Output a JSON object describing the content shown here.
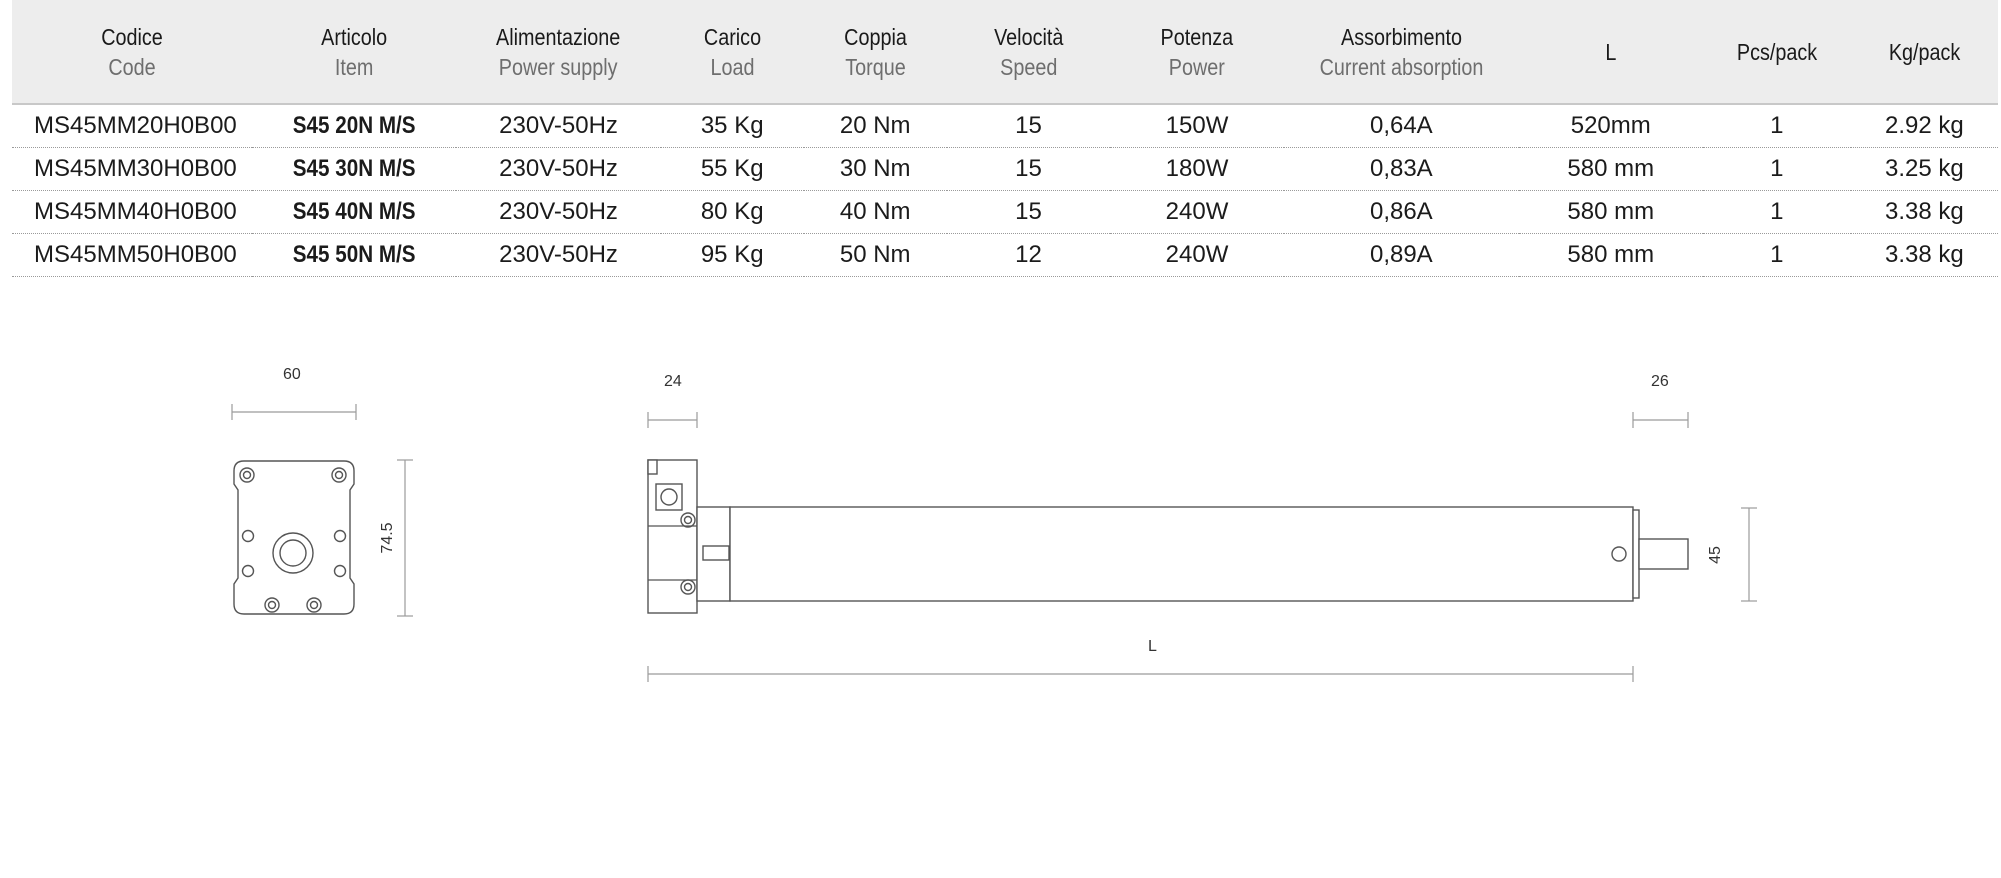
{
  "table": {
    "headers": [
      {
        "it": "Codice",
        "en": "Code"
      },
      {
        "it": "Articolo",
        "en": "Item"
      },
      {
        "it": "Alimentazione",
        "en": "Power supply"
      },
      {
        "it": "Carico",
        "en": "Load"
      },
      {
        "it": "Coppia",
        "en": "Torque"
      },
      {
        "it": "Velocità",
        "en": "Speed"
      },
      {
        "it": "Potenza",
        "en": "Power"
      },
      {
        "it": "Assorbimento",
        "en": "Current absorption"
      },
      {
        "it": "L",
        "en": ""
      },
      {
        "it": "Pcs/pack",
        "en": ""
      },
      {
        "it": "Kg/pack",
        "en": ""
      }
    ],
    "rows": [
      [
        "MS45MM20H0B00",
        "S45 20N M/S",
        "230V-50Hz",
        "35 Kg",
        "20 Nm",
        "15",
        "150W",
        "0,64A",
        "520mm",
        "1",
        "2.92 kg"
      ],
      [
        "MS45MM30H0B00",
        "S45 30N M/S",
        "230V-50Hz",
        "55 Kg",
        "30 Nm",
        "15",
        "180W",
        "0,83A",
        "580 mm",
        "1",
        "3.25 kg"
      ],
      [
        "MS45MM40H0B00",
        "S45 40N M/S",
        "230V-50Hz",
        "80 Kg",
        "40 Nm",
        "15",
        "240W",
        "0,86A",
        "580 mm",
        "1",
        "3.38 kg"
      ],
      [
        "MS45MM50H0B00",
        "S45 50N M/S",
        "230V-50Hz",
        "95 Kg",
        "50 Nm",
        "12",
        "240W",
        "0,89A",
        "580 mm",
        "1",
        "3.38 kg"
      ]
    ]
  },
  "drawing": {
    "end_view": {
      "width_label": "60",
      "height_label": "74.5"
    },
    "side_view": {
      "head_label": "24",
      "tail_label": "26",
      "diameter_label": "45",
      "length_label": "L"
    }
  },
  "colors": {
    "header_bg": "#ededed",
    "text": "#1b1b1b",
    "subtext": "#6e6e6e",
    "line": "#555555"
  }
}
